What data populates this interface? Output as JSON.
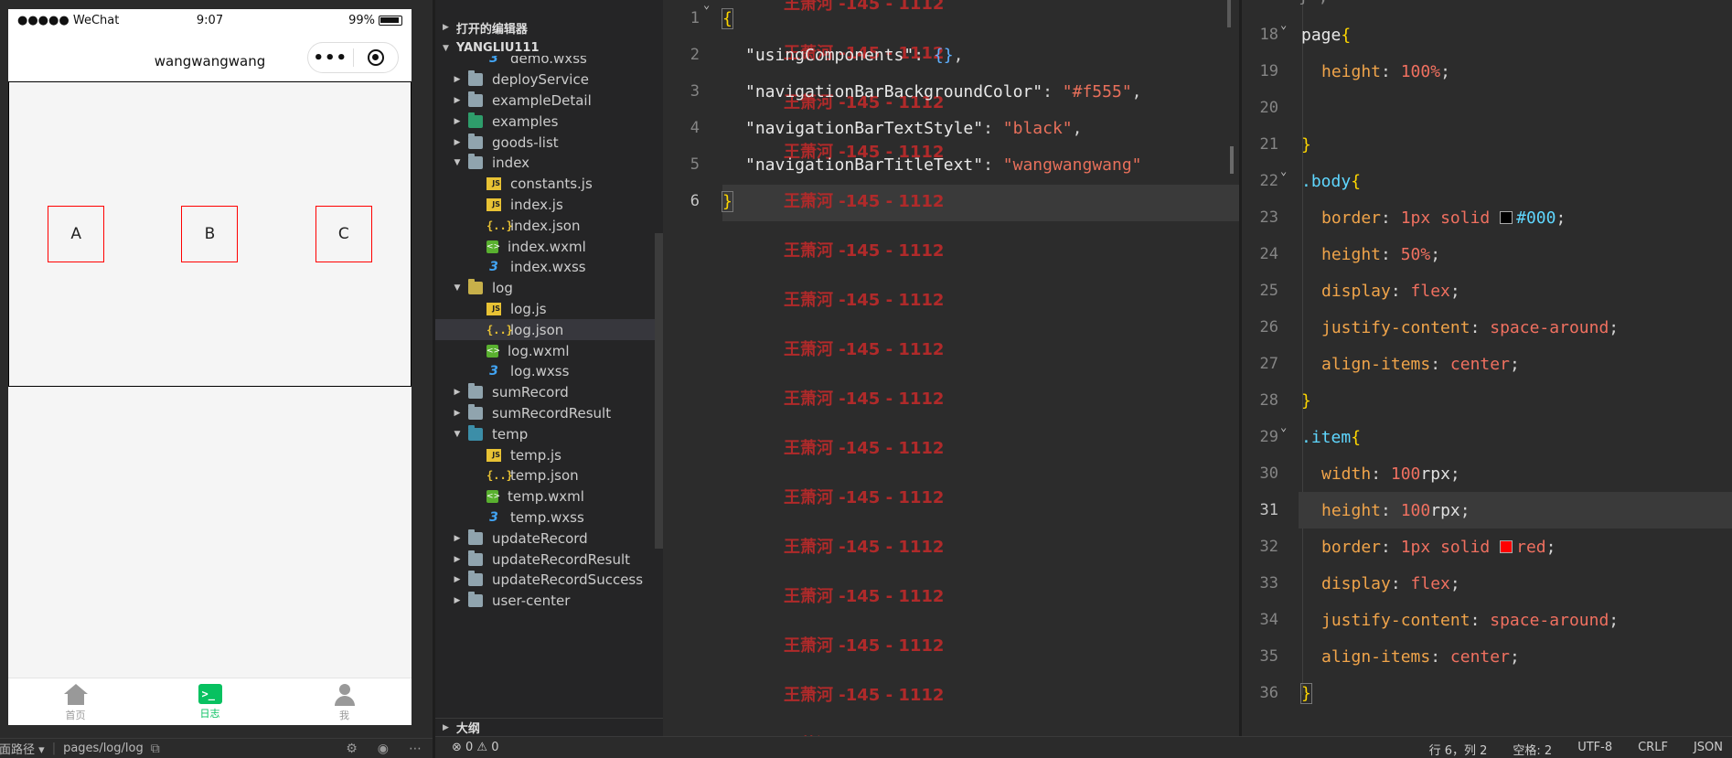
{
  "simulator": {
    "status": {
      "carrier": "●●●●● WeChat",
      "time": "9:07",
      "battery": "99%"
    },
    "nav_title": "wangwangwang",
    "capsule_dots": "•••",
    "items": [
      "A",
      "B",
      "C"
    ],
    "tabs": [
      {
        "label": "首页",
        "icon": "home-icon",
        "active": false
      },
      {
        "label": "日志",
        "icon": "terminal-icon",
        "active": true
      },
      {
        "label": "我",
        "icon": "user-icon",
        "active": false
      }
    ],
    "footer": {
      "path_label": "页面路径",
      "path": "pages/log/log"
    }
  },
  "explorer": {
    "open_editors": "打开的编辑器",
    "project": "YANGLIU111",
    "outline": "大纲",
    "tree": [
      {
        "label": "demo.wxss",
        "type": "wxss",
        "depth": 1
      },
      {
        "label": "deployService",
        "type": "folder",
        "depth": 0,
        "collapsed": true
      },
      {
        "label": "exampleDetail",
        "type": "folder",
        "depth": 0,
        "collapsed": true
      },
      {
        "label": "examples",
        "type": "folder-green",
        "depth": 0,
        "collapsed": true
      },
      {
        "label": "goods-list",
        "type": "folder",
        "depth": 0,
        "collapsed": true
      },
      {
        "label": "index",
        "type": "folder",
        "depth": 0,
        "collapsed": false
      },
      {
        "label": "constants.js",
        "type": "js",
        "depth": 1
      },
      {
        "label": "index.js",
        "type": "js",
        "depth": 1
      },
      {
        "label": "index.json",
        "type": "json",
        "depth": 1
      },
      {
        "label": "index.wxml",
        "type": "wxml",
        "depth": 1
      },
      {
        "label": "index.wxss",
        "type": "wxss",
        "depth": 1
      },
      {
        "label": "log",
        "type": "folder-yellow",
        "depth": 0,
        "collapsed": false
      },
      {
        "label": "log.js",
        "type": "js",
        "depth": 1
      },
      {
        "label": "log.json",
        "type": "json",
        "depth": 1,
        "selected": true
      },
      {
        "label": "log.wxml",
        "type": "wxml",
        "depth": 1
      },
      {
        "label": "log.wxss",
        "type": "wxss",
        "depth": 1
      },
      {
        "label": "sumRecord",
        "type": "folder",
        "depth": 0,
        "collapsed": true
      },
      {
        "label": "sumRecordResult",
        "type": "folder",
        "depth": 0,
        "collapsed": true
      },
      {
        "label": "temp",
        "type": "folder-teal",
        "depth": 0,
        "collapsed": false
      },
      {
        "label": "temp.js",
        "type": "js",
        "depth": 1
      },
      {
        "label": "temp.json",
        "type": "json",
        "depth": 1
      },
      {
        "label": "temp.wxml",
        "type": "wxml",
        "depth": 1
      },
      {
        "label": "temp.wxss",
        "type": "wxss",
        "depth": 1
      },
      {
        "label": "updateRecord",
        "type": "folder",
        "depth": 0,
        "collapsed": true
      },
      {
        "label": "updateRecordResult",
        "type": "folder",
        "depth": 0,
        "collapsed": true
      },
      {
        "label": "updateRecordSuccess",
        "type": "folder",
        "depth": 0,
        "collapsed": true
      },
      {
        "label": "user-center",
        "type": "folder",
        "depth": 0,
        "collapsed": true
      }
    ]
  },
  "editor_json": {
    "current_line": 6,
    "watermark": "王萧河 -145 - 1112",
    "lines": [
      {
        "n": "1",
        "t": "{"
      },
      {
        "n": "2",
        "k": "\"usingComponents\"",
        "v": "{}"
      },
      {
        "n": "3",
        "k": "\"navigationBarBackgroundColor\"",
        "v": "\"#f555\""
      },
      {
        "n": "4",
        "k": "\"navigationBarTextStyle\"",
        "v": "\"black\""
      },
      {
        "n": "5",
        "k": "\"navigationBarTitleText\"",
        "v": "\"wangwangwang\""
      },
      {
        "n": "6",
        "t": "}"
      }
    ]
  },
  "editor_wxss": {
    "current_line": 31,
    "lines": [
      {
        "n": "18",
        "sel": "page",
        "open": "{",
        "fold": true
      },
      {
        "n": "19",
        "prop": "height",
        "num": "100",
        "unit": "%"
      },
      {
        "n": "20"
      },
      {
        "n": "21",
        "close": "}"
      },
      {
        "n": "22",
        "cls": ".body",
        "open": "{",
        "fold": true
      },
      {
        "n": "23",
        "prop": "border",
        "val": "1px solid",
        "swatch": "#000000",
        "color": "#000"
      },
      {
        "n": "24",
        "prop": "height",
        "num": "50",
        "unit": "%"
      },
      {
        "n": "25",
        "prop": "display",
        "val": "flex"
      },
      {
        "n": "26",
        "prop": "justify-content",
        "val": "space-around"
      },
      {
        "n": "27",
        "prop": "align-items",
        "val": "center"
      },
      {
        "n": "28",
        "close": "}"
      },
      {
        "n": "29",
        "cls": ".item",
        "open": "{",
        "fold": true
      },
      {
        "n": "30",
        "prop": "width",
        "num": "100",
        "unit": "rpx"
      },
      {
        "n": "31",
        "prop": "height",
        "num": "100",
        "unit": "rpx"
      },
      {
        "n": "32",
        "prop": "border",
        "val": "1px solid",
        "swatch": "#ff0000",
        "color": "red"
      },
      {
        "n": "33",
        "prop": "display",
        "val": "flex"
      },
      {
        "n": "34",
        "prop": "justify-content",
        "val": "space-around"
      },
      {
        "n": "35",
        "prop": "align-items",
        "val": "center"
      },
      {
        "n": "36",
        "close": "}"
      }
    ]
  },
  "statusbar": {
    "problems": "⊗ 0 ⚠ 0",
    "position": "行 6，列 2",
    "spaces": "空格: 2",
    "encoding": "UTF-8",
    "eol": "CRLF",
    "language": "JSON"
  }
}
